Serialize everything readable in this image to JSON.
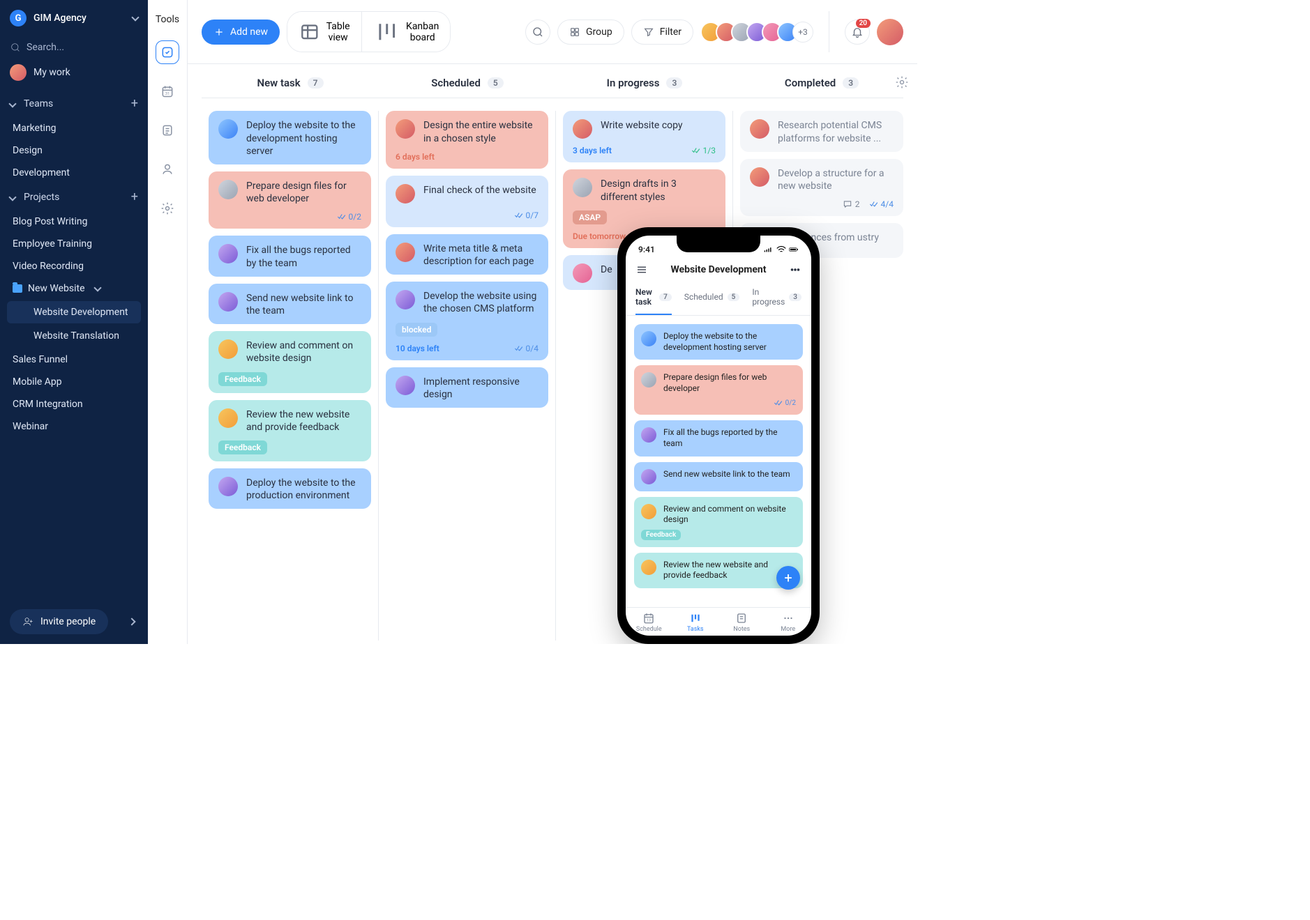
{
  "workspace": {
    "initial": "G",
    "name": "GIM Agency"
  },
  "sidebar": {
    "search_placeholder": "Search...",
    "mywork": "My work",
    "teams_label": "Teams",
    "teams": [
      "Marketing",
      "Design",
      "Development"
    ],
    "projects_label": "Projects",
    "projects_flat": [
      "Blog Post Writing",
      "Employee Training",
      "Video Recording"
    ],
    "folder": {
      "name": "New Website",
      "children": [
        "Website Development",
        "Website Translation"
      ]
    },
    "projects_after": [
      "Sales Funnel",
      "Mobile App",
      "CRM Integration",
      "Webinar"
    ],
    "invite": "Invite people"
  },
  "rail": {
    "label": "Tools"
  },
  "topbar": {
    "add": "Add new",
    "table": "Table view",
    "kanban": "Kanban board",
    "group": "Group",
    "filter": "Filter",
    "avatars_more": "+3",
    "notif_count": "20"
  },
  "board": {
    "columns": [
      {
        "title": "New task",
        "count": "7"
      },
      {
        "title": "Scheduled",
        "count": "5"
      },
      {
        "title": "In progress",
        "count": "3"
      },
      {
        "title": "Completed",
        "count": "3"
      }
    ],
    "col0": [
      {
        "title": "Deploy the website to the development hosting server",
        "bg": "bg-blue",
        "av": "a2"
      },
      {
        "title": "Prepare design files for web developer",
        "bg": "bg-salmon",
        "av": "a6",
        "check": "0/2",
        "checkcolor": ""
      },
      {
        "title": "Fix all the bugs reported by the team",
        "bg": "bg-blue",
        "av": "a3"
      },
      {
        "title": "Send new website link to the team",
        "bg": "bg-blue",
        "av": "a3"
      },
      {
        "title": "Review and comment on website design",
        "bg": "bg-teal",
        "av": "a4",
        "chip": "Feedback",
        "chipcls": "chip-feedback"
      },
      {
        "title": "Review the new website and provide feedback",
        "bg": "bg-teal",
        "av": "a4",
        "chip": "Feedback",
        "chipcls": "chip-feedback"
      },
      {
        "title": "Deploy the website to the production environment",
        "bg": "bg-blue",
        "av": "a3"
      }
    ],
    "col1": [
      {
        "title": "Design the entire website in a chosen style",
        "bg": "bg-salmon",
        "av": "a1",
        "due": "6 days left",
        "duecls": "due-red"
      },
      {
        "title": "Final check of the website",
        "bg": "bg-blue-soft",
        "av": "a1",
        "check": "0/7"
      },
      {
        "title": "Write meta title & meta description for each page",
        "bg": "bg-blue",
        "av": "a1"
      },
      {
        "title": "Develop the website using the chosen CMS platform",
        "bg": "bg-blue",
        "av": "a3",
        "chip": "blocked",
        "chipcls": "chip-blocked",
        "due": "10 days left",
        "duecls": "due-blue",
        "check": "0/4"
      },
      {
        "title": "Implement responsive design",
        "bg": "bg-blue",
        "av": "a3"
      }
    ],
    "col2": [
      {
        "title": "Write website copy",
        "bg": "bg-blue-soft",
        "av": "a1",
        "due": "3 days left",
        "duecls": "due-blue",
        "check": "1/3",
        "checkcolor": "green"
      },
      {
        "title": "Design drafts in 3 different styles",
        "bg": "bg-salmon",
        "av": "a6",
        "chip": "ASAP",
        "chipcls": "chip-asap",
        "due": "Due tomorrow",
        "duecls": "due-red"
      },
      {
        "title": "De",
        "bg": "bg-blue-soft",
        "av": "a5"
      }
    ],
    "col3": [
      {
        "title": "Research potential CMS platforms for website ...",
        "bg": "bg-gray",
        "av": "a1"
      },
      {
        "title": "Develop a structure for a new website",
        "bg": "bg-gray",
        "av": "a1",
        "comments": "2",
        "check": "4/4"
      },
      {
        "title": "0 references from ustry",
        "bg": "bg-gray",
        "av": "a1",
        "partial": true
      }
    ]
  },
  "phone": {
    "time": "9:41",
    "title": "Website Development",
    "tabs": [
      {
        "label": "New task",
        "count": "7",
        "active": true
      },
      {
        "label": "Scheduled",
        "count": "5"
      },
      {
        "label": "In progress",
        "count": "3"
      }
    ],
    "cards": [
      {
        "title": "Deploy the website to the development hosting server",
        "bg": "bg-blue",
        "av": "a2"
      },
      {
        "title": "Prepare design files for web developer",
        "bg": "bg-salmon",
        "av": "a6",
        "check": "0/2"
      },
      {
        "title": "Fix all the bugs reported by the team",
        "bg": "bg-blue",
        "av": "a3"
      },
      {
        "title": "Send new website link to the team",
        "bg": "bg-blue",
        "av": "a3"
      },
      {
        "title": "Review and comment on website design",
        "bg": "bg-teal",
        "av": "a4",
        "chip": "Feedback",
        "chipcls": "chip-feedback"
      },
      {
        "title": "Review the new website and provide feedback",
        "bg": "bg-teal",
        "av": "a4"
      }
    ],
    "nav": [
      "Schedule",
      "Tasks",
      "Notes",
      "More"
    ]
  }
}
